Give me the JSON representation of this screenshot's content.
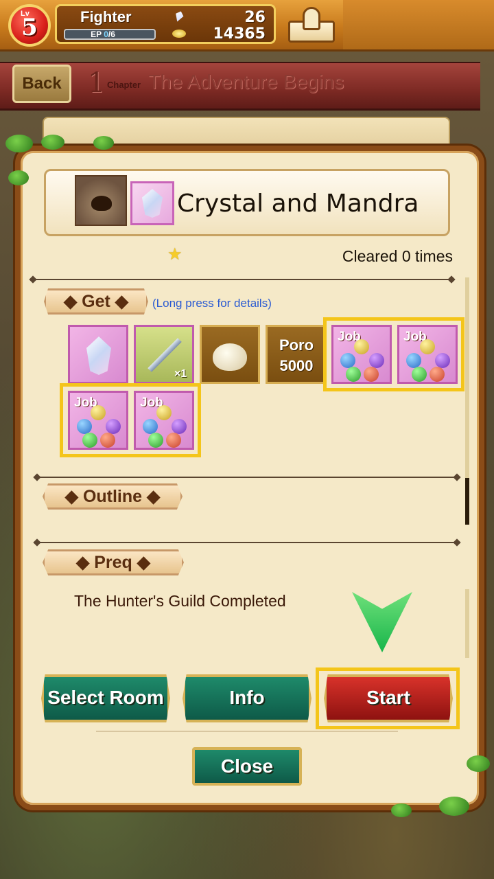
{
  "player": {
    "level_label": "Lv",
    "level": "5",
    "job": "Fighter",
    "ep_label": "EP",
    "ep_current": "0",
    "ep_max": "/6",
    "gems": "26",
    "poro": "14365"
  },
  "chapter": {
    "back_label": "Back",
    "number": "1",
    "chapter_word": "Chapter",
    "title": "The Adventure Begins"
  },
  "quest": {
    "name": "Crystal and Mandra",
    "cleared_text": "Cleared 0 times",
    "stars": 1
  },
  "sections": {
    "get_label": "Get",
    "get_hint": "(Long press for details)",
    "outline_label": "Outline",
    "prereq_label": "Preq",
    "prereq_text": "The Hunter's Guild Completed"
  },
  "rewards": [
    {
      "type": "crystal-icon",
      "highlighted": false
    },
    {
      "type": "sword-icon",
      "qty": "×1",
      "highlighted": false
    },
    {
      "type": "bag-icon",
      "highlighted": false
    },
    {
      "type": "poro-icon",
      "label": "Poro",
      "amount": "5000",
      "highlighted": false
    },
    {
      "type": "job-orb-icon",
      "label": "Job",
      "highlighted": true
    },
    {
      "type": "job-orb-icon",
      "label": "Job",
      "highlighted": true
    },
    {
      "type": "job-orb-icon",
      "label": "Job",
      "highlighted": true
    },
    {
      "type": "job-orb-icon",
      "label": "Job",
      "highlighted": true
    }
  ],
  "buttons": {
    "select_room": "Select Room",
    "info": "Info",
    "start": "Start",
    "close": "Close"
  },
  "colors": {
    "highlight": "#f4c51a",
    "teal_button": "#1e8a6a",
    "red_button": "#d8322a",
    "arrow": "#17b54a"
  }
}
